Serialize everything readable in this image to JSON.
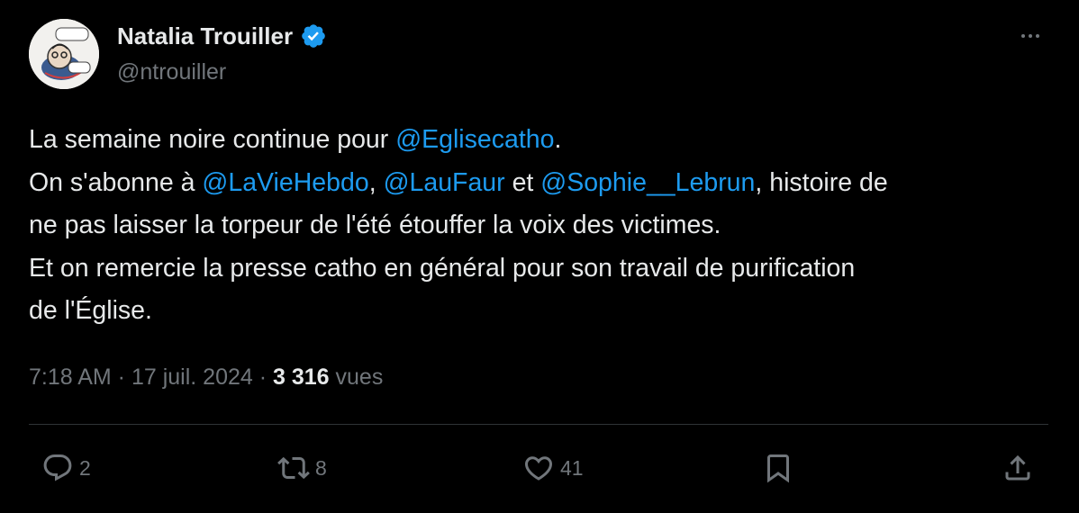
{
  "author": {
    "display_name": "Natalia Trouiller",
    "handle": "@ntrouiller",
    "verified": true,
    "avatar_text": "Questiques ? Bon ?"
  },
  "tweet": {
    "lines": [
      [
        {
          "text": "La semaine noire continue pour "
        },
        {
          "text": "@Eglisecatho",
          "mention": true
        },
        {
          "text": "."
        }
      ],
      [
        {
          "text": "On s'abonne à "
        },
        {
          "text": "@LaVieHebdo",
          "mention": true
        },
        {
          "text": ", "
        },
        {
          "text": "@LauFaur",
          "mention": true
        },
        {
          "text": " et "
        },
        {
          "text": "@Sophie__Lebrun",
          "mention": true
        },
        {
          "text": ", histoire de"
        }
      ],
      [
        {
          "text": "ne pas laisser la torpeur de l'été étouffer la voix des victimes."
        }
      ],
      [
        {
          "text": "Et on remercie la presse catho en général pour son travail de purification"
        }
      ],
      [
        {
          "text": "de l'Église."
        }
      ]
    ]
  },
  "meta": {
    "time": "7:18 AM",
    "separator": " · ",
    "date": "17 juil. 2024",
    "views_count": "3 316",
    "views_label": " vues"
  },
  "actions": {
    "replies": "2",
    "reposts": "8",
    "likes": "41"
  },
  "icons": [
    "verified-badge-icon",
    "more-icon",
    "reply-icon",
    "repost-icon",
    "like-icon",
    "bookmark-icon",
    "share-icon"
  ],
  "colors": {
    "background": "#000000",
    "text": "#e7e9ea",
    "secondary": "#71767b",
    "accent": "#1d9bf0",
    "divider": "#2f3336"
  }
}
